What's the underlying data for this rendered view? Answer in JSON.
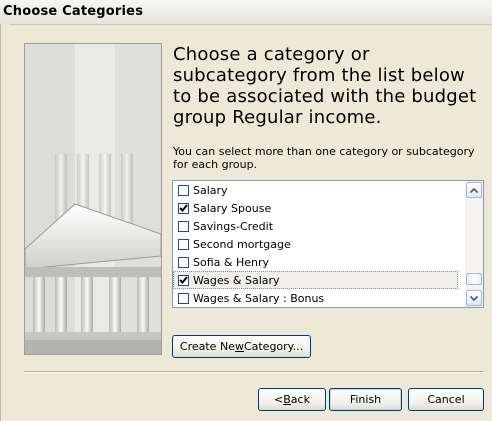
{
  "window": {
    "title": "Choose Categories"
  },
  "heading": "Choose a category or subcategory from the list below to be associated with the budget group Regular income.",
  "subtext": "You can select more than one category or subcategory for each group.",
  "list": {
    "items": [
      {
        "label": "Salary",
        "checked": false
      },
      {
        "label": "Salary Spouse",
        "checked": true
      },
      {
        "label": "Savings-Credit",
        "checked": false
      },
      {
        "label": "Second mortgage",
        "checked": false
      },
      {
        "label": "Sofia & Henry",
        "checked": false
      },
      {
        "label": "Wages & Salary",
        "checked": true
      },
      {
        "label": "Wages & Salary : Bonus",
        "checked": false
      }
    ]
  },
  "buttons": {
    "create_pre": "Create Ne",
    "create_key": "w",
    "create_post": " Category...",
    "back_pre": "< ",
    "back_key": "B",
    "back_post": "ack",
    "finish": "Finish",
    "cancel": "Cancel"
  },
  "icons": {
    "scroll_up": "chevron-up-icon",
    "scroll_down": "chevron-down-icon",
    "check": "check-icon",
    "illustration": "bank-building-illustration"
  }
}
